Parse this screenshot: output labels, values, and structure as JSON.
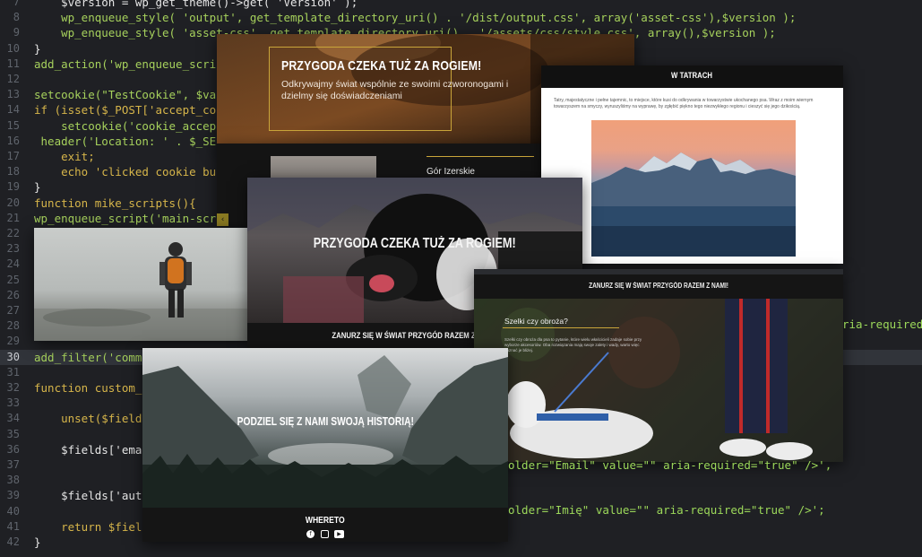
{
  "editor": {
    "lines": [
      {
        "n": "7",
        "code": "    $version = wp_get_theme()->get( 'Version' );"
      },
      {
        "n": "8",
        "code": "    wp_enqueue_style( 'output', get_template_directory_uri() . '/dist/output.css', array('asset-css'),$version );"
      },
      {
        "n": "9",
        "code": "    wp_enqueue_style( 'asset-css', get_template_directory_uri() . '/assets/css/style.css', array(),$version );"
      },
      {
        "n": "10",
        "code": "}"
      },
      {
        "n": "11",
        "code": "add_action('wp_enqueue_script"
      },
      {
        "n": "12",
        "code": ""
      },
      {
        "n": "13",
        "code": "setcookie(\"TestCookie\", $valu"
      },
      {
        "n": "14",
        "code": "if (isset($_POST['accept_cook"
      },
      {
        "n": "15",
        "code": "    setcookie('cookie_accepte"
      },
      {
        "n": "16",
        "code": " header('Location: ' . $_SERV"
      },
      {
        "n": "17",
        "code": "    exit;"
      },
      {
        "n": "18",
        "code": "    echo 'clicked cookie butt"
      },
      {
        "n": "19",
        "code": "}"
      },
      {
        "n": "20",
        "code": "function mike_scripts(){"
      },
      {
        "n": "21",
        "code": "wp_enqueue_script('main-scrip"
      },
      {
        "n": "22",
        "code": ""
      },
      {
        "n": "23",
        "code": ""
      },
      {
        "n": "24",
        "code": ""
      },
      {
        "n": "25",
        "code": ""
      },
      {
        "n": "26",
        "code": ""
      },
      {
        "n": "27",
        "code": ""
      },
      {
        "n": "28",
        "code": ""
      },
      {
        "n": "29",
        "code": ""
      },
      {
        "n": "30",
        "code": "add_filter('comme"
      },
      {
        "n": "31",
        "code": ""
      },
      {
        "n": "32",
        "code": "function custom_c"
      },
      {
        "n": "33",
        "code": ""
      },
      {
        "n": "34",
        "code": "    unset($fields"
      },
      {
        "n": "35",
        "code": ""
      },
      {
        "n": "36",
        "code": "    $fields['emai"
      },
      {
        "n": "37",
        "code": ""
      },
      {
        "n": "38",
        "code": ""
      },
      {
        "n": "39",
        "code": "    $fields['autho"
      },
      {
        "n": "40",
        "code": ""
      },
      {
        "n": "41",
        "code": "    return $fields;"
      },
      {
        "n": "42",
        "code": "}"
      }
    ],
    "active_line": "30",
    "fragments": {
      "right_aria": "ria-required=",
      "email_tail": "older=\"Email\" value=\"\" aria-required=\"true\" />',",
      "imie_tail": "older=\"Imię\" value=\"\" aria-required=\"true\" />';"
    }
  },
  "hero": {
    "heading": "PRZYGODA CZEKA TUŻ ZA ROGIEM!",
    "text": "Odkrywajmy świat wspólnie ze swoimi czworonogami i dzielmy się doświadczeniami"
  },
  "strip": {
    "caption": "Gór Izerskie",
    "arrow": "‹"
  },
  "tatry": {
    "title": "W TATRACH",
    "body": "Tatry, majestatyczne i pełne tajemnic, to miejsce, które kusi do odkrywania w towarzystwie ukochanego psa. Wraz z moim wiernym towarzyszem na smyczy, wyruszyliśmy na wyprawę, by zgłębić piękno tego niezwykłego regionu i cieszyć się jego dzikością."
  },
  "dog": {
    "heading": "PRZYGODA CZEKA TUŻ ZA ROGIEM!",
    "subheading": "ZANURZ SIĘ W ŚWIAT PRZYGÓD RAZEM Z NAMI!"
  },
  "szelki": {
    "title": "ZANURZ SIĘ W ŚWIAT PRZYGÓD RAZEM Z NAMI!",
    "question": "Szelki czy obroża?",
    "text": "Szelki czy obroża dla psa to pytanie, które wielu właścicieli zadaje sobie przy wyborze akcesoriów. Oba rozwiązania mają swoje zalety i wady, warto więc poznać je bliżej."
  },
  "yosemite": {
    "heading": "PODZIEL SIĘ Z NAMI SWOJĄ HISTORIĄ!",
    "footer_brand": "WHERETO",
    "social": [
      "facebook-icon",
      "instagram-icon",
      "youtube-icon"
    ]
  },
  "colors": {
    "editor_bg": "#1f2024",
    "accent_gold": "#c9a53a",
    "keyword": "#d6b54a",
    "function": "#a6d15c"
  }
}
